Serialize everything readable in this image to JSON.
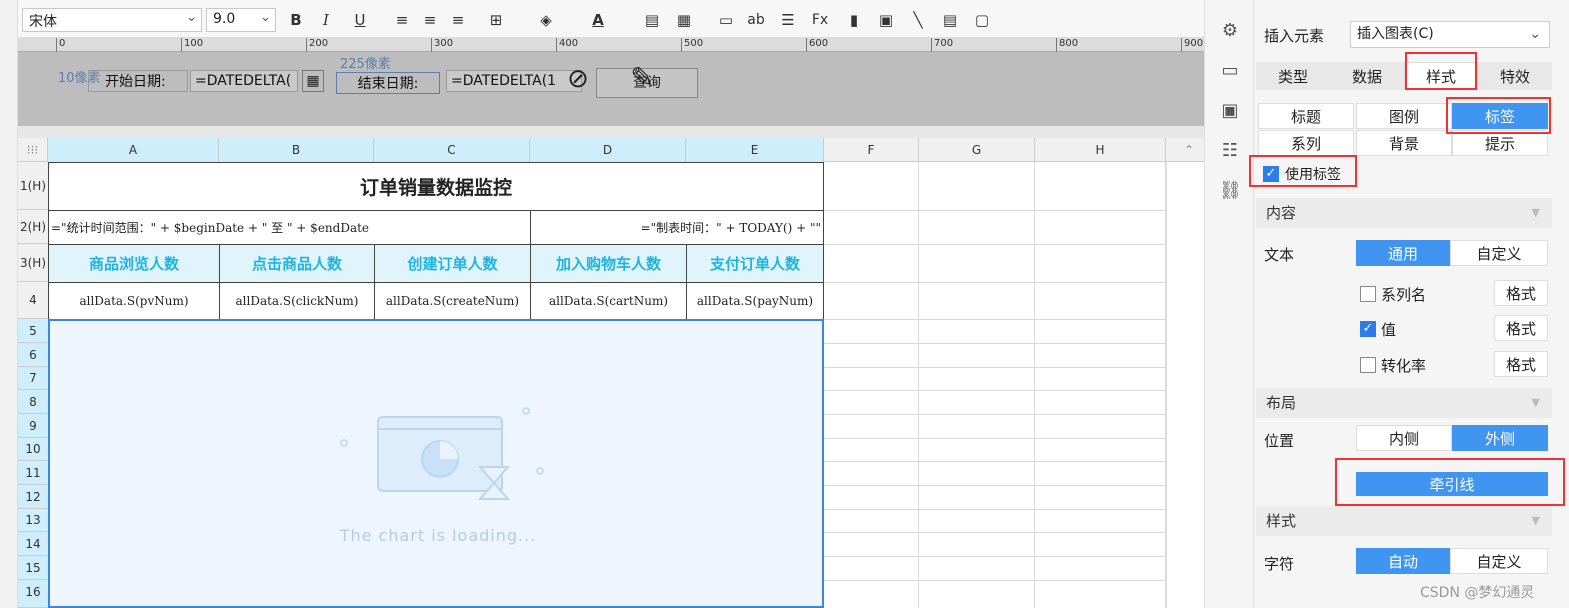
{
  "toolbar": {
    "font_name": "宋体",
    "font_size": "9.0",
    "ruler_ticks": [
      "0",
      "100",
      "200",
      "300",
      "400",
      "500",
      "600",
      "700",
      "800",
      "900"
    ]
  },
  "param": {
    "left_hint": "10像素",
    "top_hint": "225像素",
    "start_label": "开始日期:",
    "start_value": "=DATEDELTA(",
    "end_label": "结束日期:",
    "end_value": "=DATEDELTA(1",
    "query_button": "查询"
  },
  "sheet": {
    "columns": [
      "A",
      "B",
      "C",
      "D",
      "E",
      "F",
      "G",
      "H"
    ],
    "rows": [
      "1(H)",
      "2(H)",
      "3(H)",
      "4",
      "5",
      "6",
      "7",
      "8",
      "9",
      "10",
      "11",
      "12",
      "13",
      "14",
      "15",
      "16"
    ],
    "title": "订单销量数据监控",
    "formula_left": "=\"统计时间范围：\" + $beginDate + \" 至 \" + $endDate",
    "formula_right": "=\"制表时间：\" + TODAY() + \"\"",
    "headers": [
      "商品浏览人数",
      "点击商品人数",
      "创建订单人数",
      "加入购物车人数",
      "支付订单人数"
    ],
    "data_cells": [
      "allData.S(pvNum)",
      "allData.S(clickNum)",
      "allData.S(createNum)",
      "allData.S(cartNum)",
      "allData.S(payNum)"
    ],
    "chart_loading": "The chart is loading..."
  },
  "panel": {
    "insert_label": "插入元素",
    "insert_value": "插入图表(C)",
    "tabs": [
      "类型",
      "数据",
      "样式",
      "特效"
    ],
    "subtabs": [
      "标题",
      "图例",
      "标签",
      "系列",
      "背景",
      "提示"
    ],
    "use_label": "使用标签",
    "content_section": "内容",
    "text_label": "文本",
    "text_options": [
      "通用",
      "自定义"
    ],
    "checks": [
      {
        "label": "系列名",
        "checked": false
      },
      {
        "label": "值",
        "checked": true
      },
      {
        "label": "转化率",
        "checked": false
      }
    ],
    "format_btn": "格式",
    "layout_section": "布局",
    "position_label": "位置",
    "position_options": [
      "内侧",
      "外侧"
    ],
    "leader_btn": "牵引线",
    "style_section": "样式",
    "char_label": "字符",
    "char_options": [
      "自动",
      "自定义"
    ]
  },
  "watermark": "CSDN @梦幻通灵",
  "colors": {
    "accent": "#3f95f0",
    "header_text": "#1fb3e0",
    "highlight": "#e33333"
  }
}
